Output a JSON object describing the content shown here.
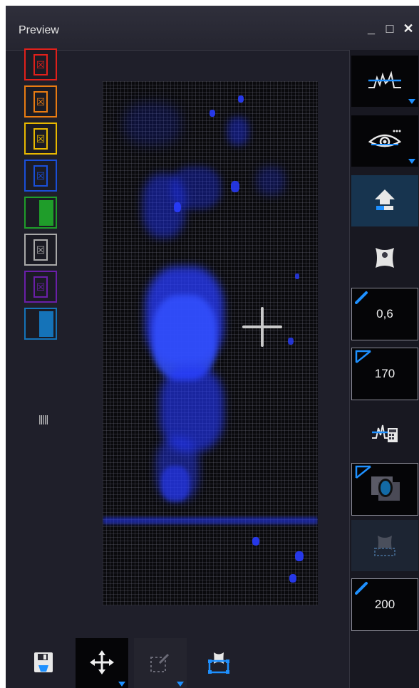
{
  "window": {
    "title": "Preview",
    "controls": {
      "minimize": "_",
      "maximize": "□",
      "close": "✕"
    }
  },
  "filters": [
    {
      "name": "red",
      "color": "#e0201b",
      "style": "x"
    },
    {
      "name": "orange",
      "color": "#e87b12",
      "style": "x"
    },
    {
      "name": "yellow",
      "color": "#e8b800",
      "style": "x"
    },
    {
      "name": "blue",
      "color": "#1a4fd8",
      "style": "x"
    },
    {
      "name": "green",
      "color": "#1f9d2a",
      "style": "solid"
    },
    {
      "name": "gray",
      "color": "#a8a8a8",
      "style": "x"
    },
    {
      "name": "purple",
      "color": "#6a1fa8",
      "style": "x"
    },
    {
      "name": "cyan",
      "color": "#1573b8",
      "style": "solid"
    }
  ],
  "filter_x_glyph": "☒",
  "barcode_glyph": "|||||",
  "right_toolbar": {
    "threshold_value": "0,6",
    "angle_value": "170",
    "size_value": "200"
  },
  "icons": {
    "histogram": "histogram-icon",
    "visibility": "eye-icon",
    "unload": "eject-icon",
    "bone": "bone-icon",
    "calculator": "histogram-calc-icon",
    "roi": "roi-mask-icon",
    "layer": "layer-icon",
    "save": "save-icon",
    "move": "move-icon",
    "select": "select-tool-icon",
    "crop": "crop-icon"
  },
  "colors": {
    "accent": "#1e90ff",
    "signal": "#1a2bff"
  }
}
